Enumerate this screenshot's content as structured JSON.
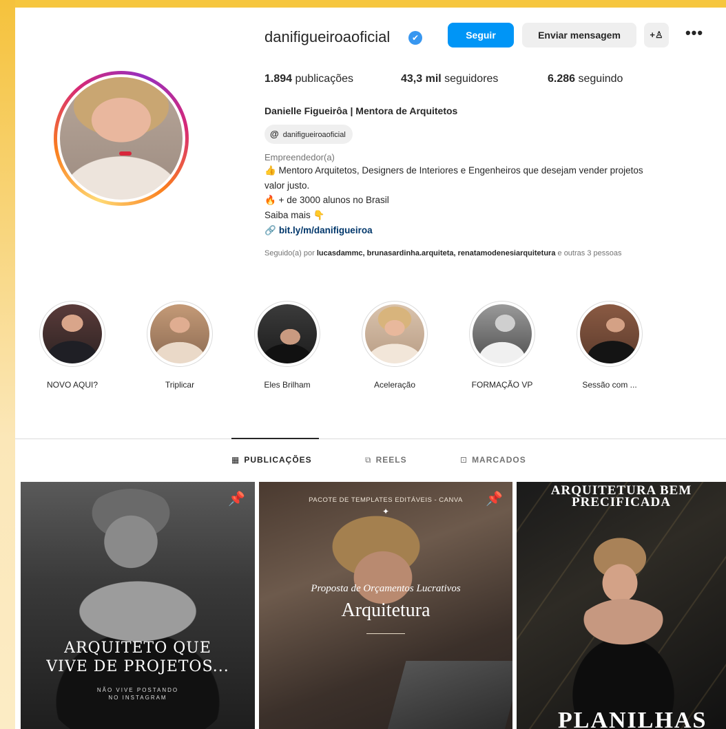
{
  "profile": {
    "username": "danifigueiroaoficial",
    "verified_glyph": "✔",
    "follow_label": "Seguir",
    "message_label": "Enviar mensagem",
    "add_user_glyph": "+♙",
    "more_glyph": "•••",
    "stats": {
      "posts_count": "1.894",
      "posts_label": "publicações",
      "followers_count": "43,3 mil",
      "followers_label": "seguidores",
      "following_count": "6.286",
      "following_label": "seguindo"
    },
    "display_name": "Danielle Figueirôa | Mentora de Arquitetos",
    "threads_handle": "danifigueiroaoficial",
    "category": "Empreendedor(a)",
    "bio_lines": [
      "👍 Mentoro Arquitetos, Designers de Interiores e Engenheiros que desejam vender projetos",
      "valor justo.",
      "🔥 + de 3000 alunos no Brasil",
      "Saiba mais 👇"
    ],
    "link": "bit.ly/m/danifigueiroa",
    "followed_by_prefix": "Seguido(a) por",
    "followed_by_names": "lucasdammc, brunasardinha.arquiteta, renatamodenesiarquitetura",
    "followed_by_suffix": "e outras 3 pessoas"
  },
  "highlights": [
    {
      "label": "NOVO AQUI?",
      "img": "portrait-dark"
    },
    {
      "label": "Triplicar",
      "img": "portrait-beige"
    },
    {
      "label": "Eles Brilham",
      "img": "portrait-black"
    },
    {
      "label": "Aceleração",
      "img": "portrait-cream"
    },
    {
      "label": "FORMAÇÃO VP",
      "img": "portrait-bw"
    },
    {
      "label": "Sessão com ...",
      "img": "portrait-brick"
    }
  ],
  "tabs": [
    {
      "label": "PUBLICAÇÕES",
      "icon": "grid-icon",
      "glyph": "▦",
      "active": true
    },
    {
      "label": "REELS",
      "icon": "reels-icon",
      "glyph": "⧉",
      "active": false
    },
    {
      "label": "MARCADOS",
      "icon": "tagged-icon",
      "glyph": "⊡",
      "active": false
    }
  ],
  "posts": [
    {
      "pinned": true,
      "title_line1": "ARQUITETO QUE",
      "title_line2": "VIVE DE PROJETOS...",
      "sub_line1": "NÃO VIVE POSTANDO",
      "sub_line2": "NO INSTAGRAM"
    },
    {
      "pinned": true,
      "top_text": "PACOTE DE TEMPLATES EDITÁVEIS - CANVA",
      "script_text": "Proposta de Orçamentos Lucrativos",
      "big_text": "Arquitetura"
    },
    {
      "pinned": false,
      "title_line1": "ARQUITETURA BEM",
      "title_line2": "PRECIFICADA",
      "bottom_text": "PLANILHAS"
    }
  ],
  "colors": {
    "frame": "#f6c63e",
    "follow_button": "#0095f6",
    "verified": "#3897f0",
    "link": "#00376b",
    "muted": "#737373"
  }
}
